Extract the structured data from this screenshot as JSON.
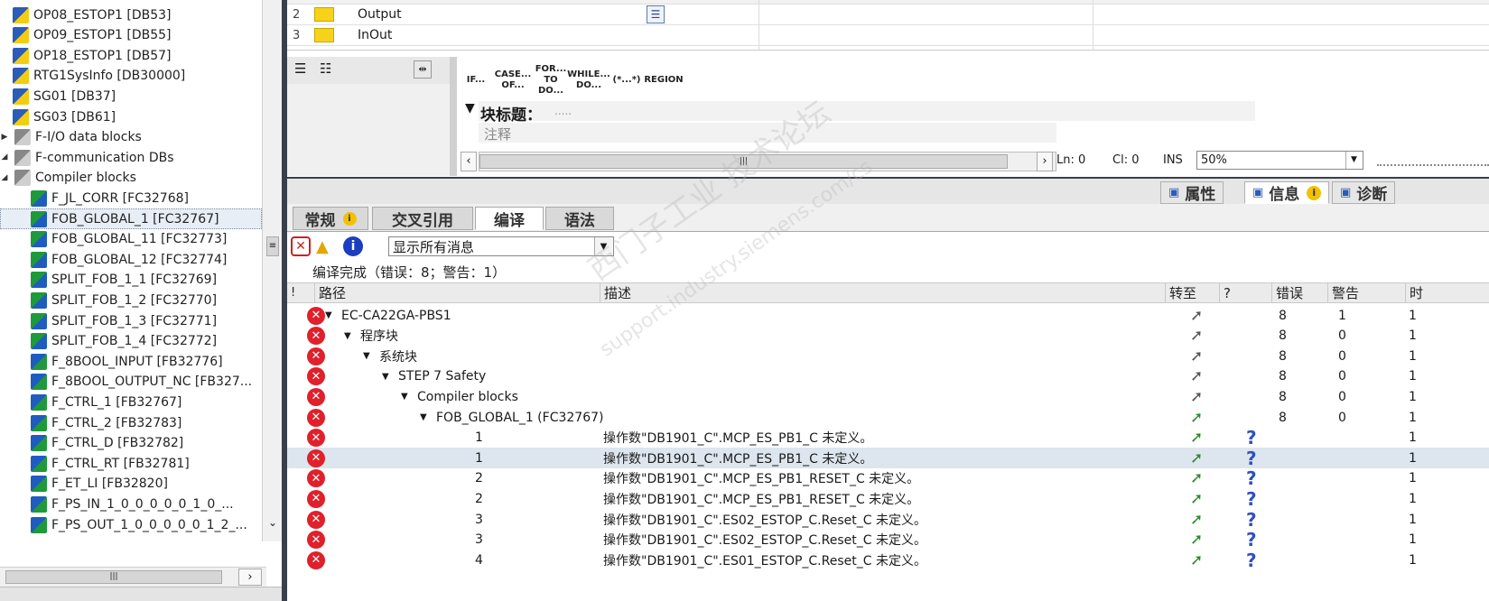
{
  "tree": {
    "items": [
      {
        "label": "OP08_ESTOP1 [DB53]",
        "icon": "db-icon",
        "indent": 1
      },
      {
        "label": "OP09_ESTOP1 [DB55]",
        "icon": "db-icon",
        "indent": 1
      },
      {
        "label": "OP18_ESTOP1 [DB57]",
        "icon": "db-icon",
        "indent": 1
      },
      {
        "label": "RTG1SysInfo [DB30000]",
        "icon": "db-icon",
        "indent": 1
      },
      {
        "label": "SG01 [DB37]",
        "icon": "db-icon",
        "indent": 1
      },
      {
        "label": "SG03 [DB61]",
        "icon": "db-icon",
        "indent": 1
      },
      {
        "label": "F-I/O data blocks",
        "icon": "folder-icon",
        "indent": 0,
        "expander": "collapsed"
      },
      {
        "label": "F-communication DBs",
        "icon": "folder-icon",
        "indent": 0,
        "expander": "expanded"
      },
      {
        "label": "Compiler blocks",
        "icon": "folder-icon",
        "indent": 0,
        "expander": "expanded"
      },
      {
        "label": "F_JL_CORR [FC32768]",
        "icon": "fc-icon",
        "indent": 2
      },
      {
        "label": "FOB_GLOBAL_1 [FC32767]",
        "icon": "fc-icon",
        "indent": 2,
        "selected": true
      },
      {
        "label": "FOB_GLOBAL_11 [FC32773]",
        "icon": "fc-icon",
        "indent": 2
      },
      {
        "label": "FOB_GLOBAL_12 [FC32774]",
        "icon": "fc-icon",
        "indent": 2
      },
      {
        "label": "SPLIT_FOB_1_1 [FC32769]",
        "icon": "fc-icon",
        "indent": 2
      },
      {
        "label": "SPLIT_FOB_1_2 [FC32770]",
        "icon": "fc-icon",
        "indent": 2
      },
      {
        "label": "SPLIT_FOB_1_3 [FC32771]",
        "icon": "fc-icon",
        "indent": 2
      },
      {
        "label": "SPLIT_FOB_1_4 [FC32772]",
        "icon": "fc-icon",
        "indent": 2
      },
      {
        "label": "F_8BOOL_INPUT [FB32776]",
        "icon": "fb-icon",
        "indent": 2
      },
      {
        "label": "F_8BOOL_OUTPUT_NC [FB327...",
        "icon": "fb-icon",
        "indent": 2
      },
      {
        "label": "F_CTRL_1 [FB32767]",
        "icon": "fb-icon",
        "indent": 2
      },
      {
        "label": "F_CTRL_2 [FB32783]",
        "icon": "fb-icon",
        "indent": 2
      },
      {
        "label": "F_CTRL_D [FB32782]",
        "icon": "fb-icon",
        "indent": 2
      },
      {
        "label": "F_CTRL_RT [FB32781]",
        "icon": "fb-icon",
        "indent": 2
      },
      {
        "label": "F_ET_LI [FB32820]",
        "icon": "fb-icon",
        "indent": 2
      },
      {
        "label": "F_PS_IN_1_0_0_0_0_0_1_0_...",
        "icon": "fb-icon",
        "indent": 2
      },
      {
        "label": "F_PS_OUT_1_0_0_0_0_0_1_2_...",
        "icon": "fb-icon",
        "indent": 2
      }
    ]
  },
  "interface": {
    "rows": [
      {
        "num": "2",
        "name": "Output"
      },
      {
        "num": "3",
        "name": "InOut"
      }
    ]
  },
  "editor": {
    "keywords": [
      "IF...",
      "CASE... OF...",
      "FOR... TO DO...",
      "WHILE... DO...",
      "(*...*)",
      "REGION"
    ],
    "block_title_label": "块标题：",
    "block_title_value": ".....",
    "comment_placeholder": "注释",
    "status": {
      "ln": "Ln: 0",
      "cl": "Cl: 0",
      "mode": "INS",
      "zoom": "50%"
    }
  },
  "inspector": {
    "tabs": [
      "属性",
      "信息",
      "诊断"
    ],
    "active_tab": "信息",
    "subtabs": [
      "常规",
      "交叉引用",
      "编译",
      "语法"
    ],
    "active_subtab": "编译",
    "filter_value": "显示所有消息",
    "summary": "编译完成（错误：8；警告：1）",
    "columns": [
      "!",
      "路径",
      "描述",
      "转至",
      "?",
      "错误",
      "警告",
      "时"
    ]
  },
  "messages": [
    {
      "path": "EC-CA22GA-PBS1",
      "level": 0,
      "expander": true,
      "desc": "",
      "errors": "8",
      "warnings": "1",
      "goto_color": "#555555",
      "q": false,
      "time": "1"
    },
    {
      "path": "程序块",
      "level": 1,
      "expander": true,
      "desc": "",
      "errors": "8",
      "warnings": "0",
      "goto_color": "#555555",
      "q": false,
      "time": "1"
    },
    {
      "path": "系统块",
      "level": 2,
      "expander": true,
      "desc": "",
      "errors": "8",
      "warnings": "0",
      "goto_color": "#555555",
      "q": false,
      "time": "1"
    },
    {
      "path": "STEP 7 Safety",
      "level": 3,
      "expander": true,
      "desc": "",
      "errors": "8",
      "warnings": "0",
      "goto_color": "#555555",
      "q": false,
      "time": "1"
    },
    {
      "path": "Compiler blocks",
      "level": 4,
      "expander": true,
      "desc": "",
      "errors": "8",
      "warnings": "0",
      "goto_color": "#555555",
      "q": false,
      "time": "1"
    },
    {
      "path": "FOB_GLOBAL_1 (FC32767)",
      "level": 5,
      "expander": true,
      "desc": "",
      "errors": "8",
      "warnings": "0",
      "goto_color": "#2a8a2a",
      "q": false,
      "time": "1"
    },
    {
      "path": "1",
      "level": 9,
      "expander": false,
      "desc": "操作数\"DB1901_C\".MCP_ES_PB1_C 未定义。",
      "errors": "",
      "warnings": "",
      "goto_color": "#2a8a2a",
      "q": true,
      "time": "1"
    },
    {
      "path": "1",
      "level": 9,
      "expander": false,
      "desc": "操作数\"DB1901_C\".MCP_ES_PB1_C 未定义。",
      "errors": "",
      "warnings": "",
      "goto_color": "#2a8a2a",
      "q": true,
      "time": "1",
      "highlight": true
    },
    {
      "path": "2",
      "level": 9,
      "expander": false,
      "desc": "操作数\"DB1901_C\".MCP_ES_PB1_RESET_C 未定义。",
      "errors": "",
      "warnings": "",
      "goto_color": "#2a8a2a",
      "q": true,
      "time": "1"
    },
    {
      "path": "2",
      "level": 9,
      "expander": false,
      "desc": "操作数\"DB1901_C\".MCP_ES_PB1_RESET_C 未定义。",
      "errors": "",
      "warnings": "",
      "goto_color": "#2a8a2a",
      "q": true,
      "time": "1"
    },
    {
      "path": "3",
      "level": 9,
      "expander": false,
      "desc": "操作数\"DB1901_C\".ES02_ESTOP_C.Reset_C 未定义。",
      "errors": "",
      "warnings": "",
      "goto_color": "#2a8a2a",
      "q": true,
      "time": "1"
    },
    {
      "path": "3",
      "level": 9,
      "expander": false,
      "desc": "操作数\"DB1901_C\".ES02_ESTOP_C.Reset_C 未定义。",
      "errors": "",
      "warnings": "",
      "goto_color": "#2a8a2a",
      "q": true,
      "time": "1"
    },
    {
      "path": "4",
      "level": 9,
      "expander": false,
      "desc": "操作数\"DB1901_C\".ES01_ESTOP_C.Reset_C 未定义。",
      "errors": "",
      "warnings": "",
      "goto_color": "#2a8a2a",
      "q": true,
      "time": "1"
    }
  ],
  "watermark": {
    "line1": "西门子工业 技术论坛",
    "line2": "support.industry.siemens.com/cs"
  }
}
